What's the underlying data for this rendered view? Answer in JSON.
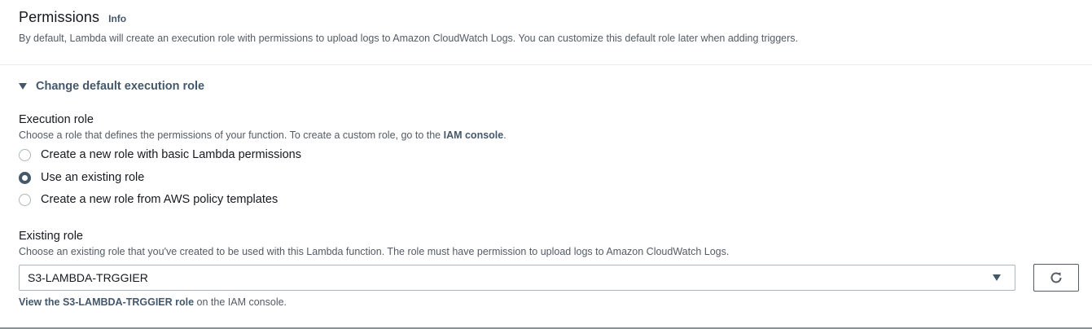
{
  "header": {
    "title": "Permissions",
    "info": "Info",
    "description": "By default, Lambda will create an execution role with permissions to upload logs to Amazon CloudWatch Logs. You can customize this default role later when adding triggers."
  },
  "expander": {
    "label": "Change default execution role"
  },
  "execution_role": {
    "label": "Execution role",
    "description_prefix": "Choose a role that defines the permissions of your function. To create a custom role, go to the ",
    "description_link": "IAM console",
    "description_suffix": ".",
    "options": [
      {
        "label": "Create a new role with basic Lambda permissions",
        "selected": false
      },
      {
        "label": "Use an existing role",
        "selected": true
      },
      {
        "label": "Create a new role from AWS policy templates",
        "selected": false
      }
    ]
  },
  "existing_role": {
    "label": "Existing role",
    "description": "Choose an existing role that you've created to be used with this Lambda function. The role must have permission to upload logs to Amazon CloudWatch Logs.",
    "selected_value": "S3-LAMBDA-TRGGIER",
    "view_link": "View the S3-LAMBDA-TRGGIER role",
    "view_suffix": " on the IAM console."
  },
  "icons": {
    "refresh": "refresh-icon",
    "dropdown": "caret-down-icon",
    "expander": "caret-down-icon"
  },
  "colors": {
    "accent": "#44576b",
    "text": "#16191f",
    "muted": "#545b64",
    "border": "#aab7b8"
  }
}
